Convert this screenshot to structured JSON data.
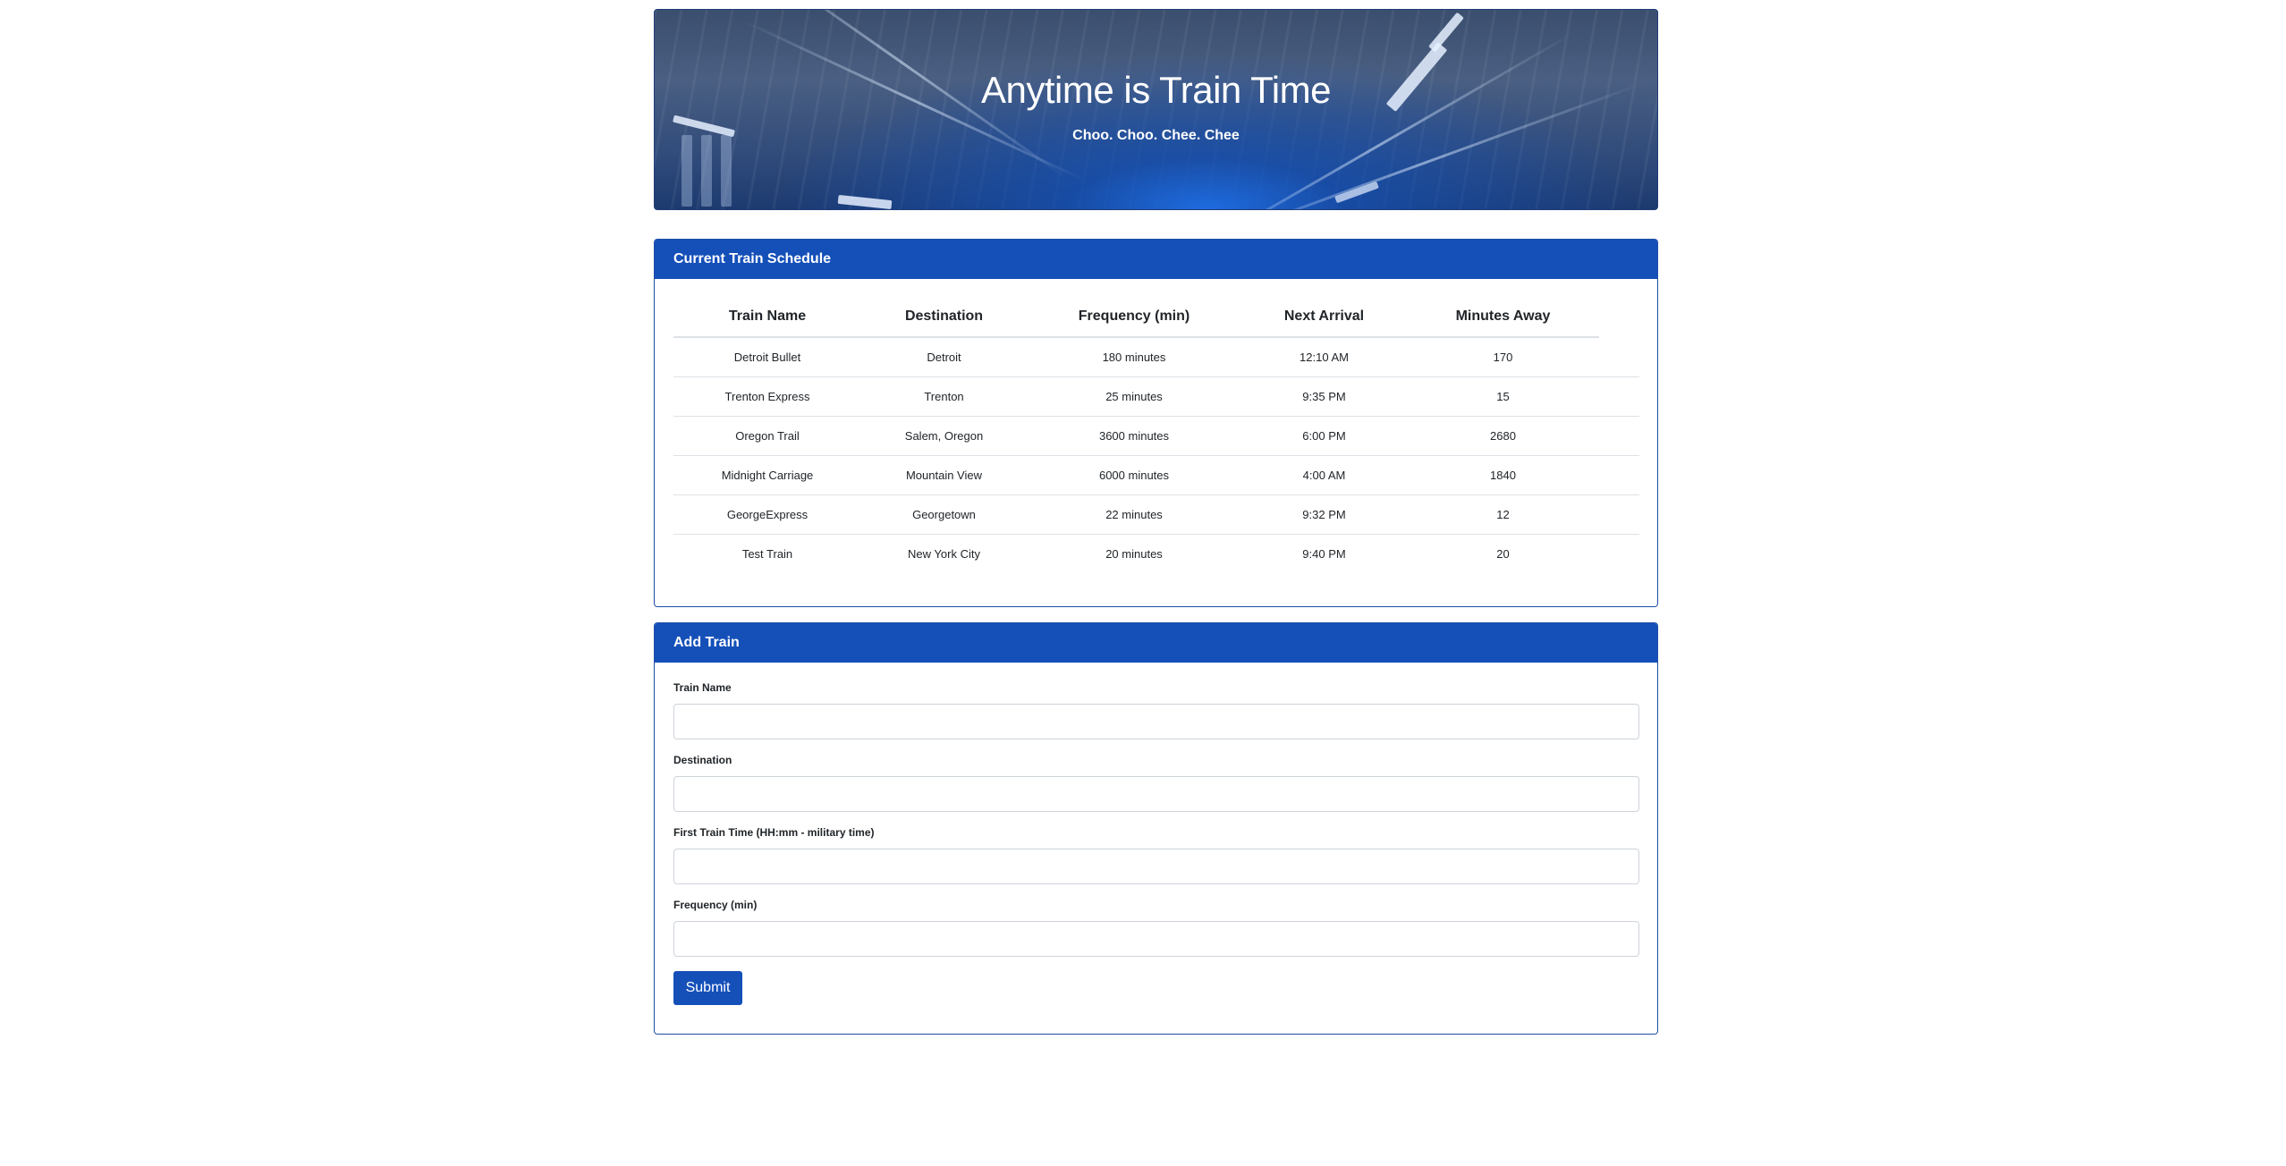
{
  "jumbotron": {
    "title": "Anytime is Train Time",
    "subtitle": "Choo. Choo. Chee. Chee"
  },
  "schedule": {
    "header": "Current Train Schedule",
    "columns": [
      "Train Name",
      "Destination",
      "Frequency (min)",
      "Next Arrival",
      "Minutes Away"
    ],
    "rows": [
      [
        "Detroit Bullet",
        "Detroit",
        "180 minutes",
        "12:10 AM",
        "170"
      ],
      [
        "Trenton Express",
        "Trenton",
        "25 minutes",
        "9:35 PM",
        "15"
      ],
      [
        "Oregon Trail",
        "Salem, Oregon",
        "3600 minutes",
        "6:00 PM",
        "2680"
      ],
      [
        "Midnight Carriage",
        "Mountain View",
        "6000 minutes",
        "4:00 AM",
        "1840"
      ],
      [
        "GeorgeExpress",
        "Georgetown",
        "22 minutes",
        "9:32 PM",
        "12"
      ],
      [
        "Test Train",
        "New York City",
        "20 minutes",
        "9:40 PM",
        "20"
      ]
    ]
  },
  "add_train": {
    "header": "Add Train",
    "fields": {
      "train_name": {
        "label": "Train Name",
        "value": ""
      },
      "destination": {
        "label": "Destination",
        "value": ""
      },
      "first_train_time": {
        "label": "First Train Time (HH:mm - military time)",
        "value": ""
      },
      "frequency": {
        "label": "Frequency (min)",
        "value": ""
      }
    },
    "submit_label": "Submit"
  },
  "colors": {
    "primary": "#1550b9",
    "border": "#1f4da6",
    "table_rule": "#dee2e6"
  }
}
